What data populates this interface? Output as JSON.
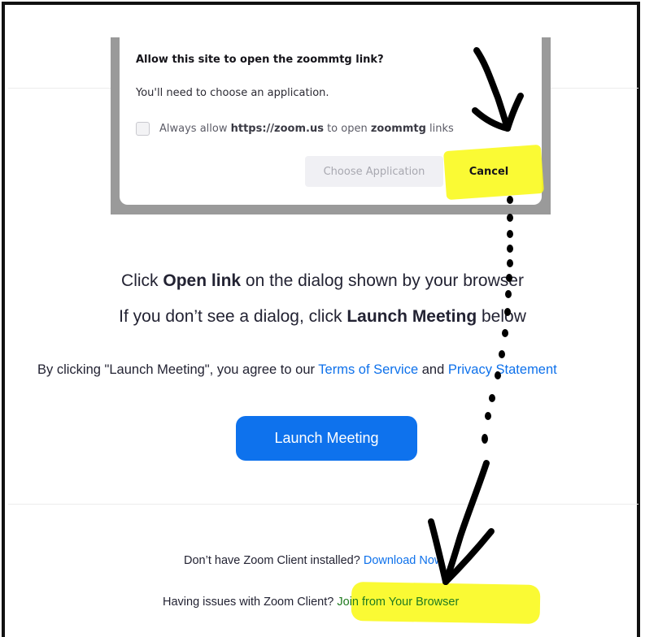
{
  "dialog": {
    "title": "Allow this site to open the zoommtg link?",
    "subtitle": "You'll need to choose an application.",
    "checkbox_prefix": "Always allow ",
    "checkbox_site": "https://zoom.us",
    "checkbox_mid": " to open ",
    "checkbox_scheme": "zoommtg",
    "checkbox_suffix": " links",
    "checkbox_checked": false,
    "choose_button": "Choose Application",
    "cancel_button": "Cancel"
  },
  "main": {
    "line1_prefix": "Click ",
    "line1_bold": "Open link",
    "line1_suffix": " on the dialog shown by your browser",
    "line2_prefix": "If you don’t see a dialog, click ",
    "line2_bold": "Launch Meeting",
    "line2_suffix": " below",
    "terms_prefix": "By clicking \"Launch Meeting\", you agree to our ",
    "terms_link": "Terms of Service",
    "terms_mid": " and ",
    "privacy_link": "Privacy Statement",
    "launch_button": "Launch Meeting"
  },
  "footer": {
    "no_client_text": "Don’t have Zoom Client installed? ",
    "download_link": "Download Now",
    "issues_text": "Having issues with Zoom Client? ",
    "browser_link": "Join from Your Browser"
  },
  "colors": {
    "link": "#0e71eb",
    "launch_button": "#0e72ed",
    "highlight": "#fafa1e"
  }
}
